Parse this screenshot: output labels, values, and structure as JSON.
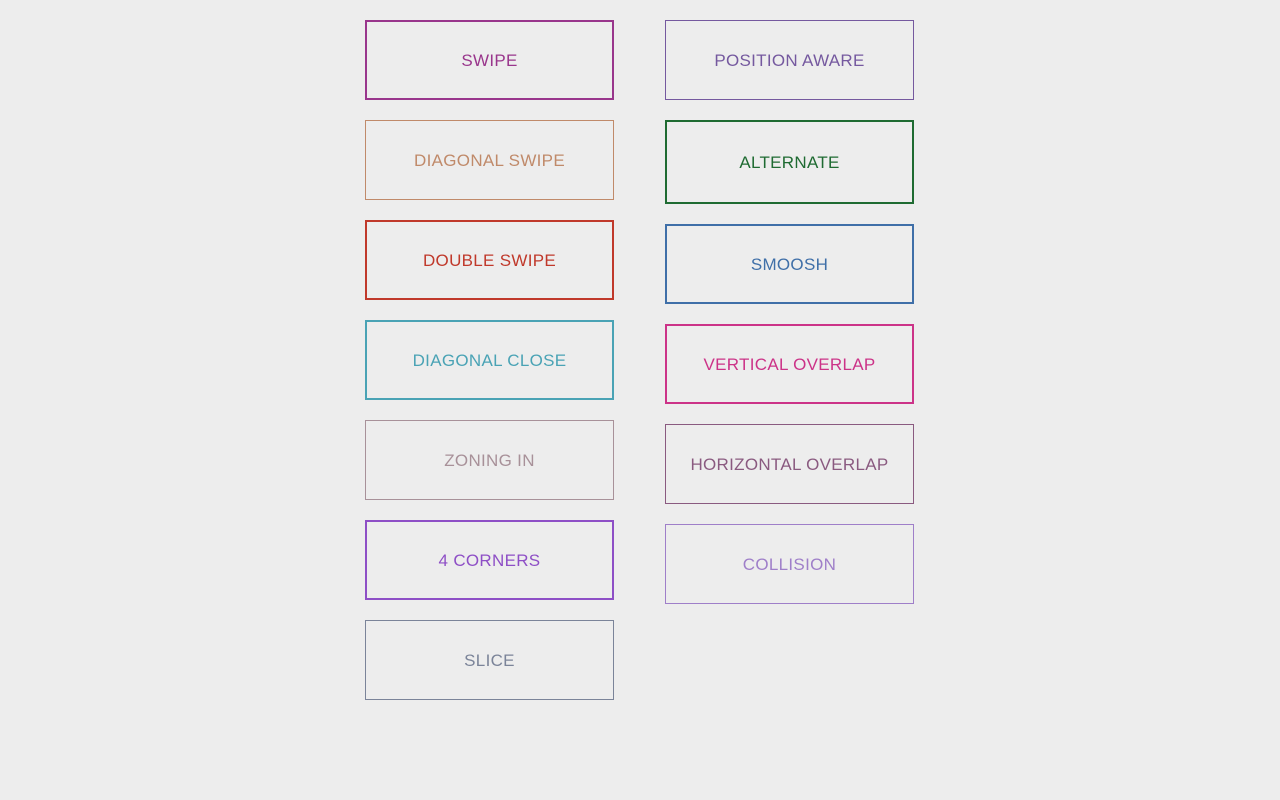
{
  "page": {
    "background_color": "#ededed",
    "cell_background_color": "#ededed"
  },
  "grid": {
    "columns": [
      {
        "name": "left-column",
        "cells": [
          {
            "label": "SWIPE",
            "color": "#99368c",
            "border_width": 2,
            "height": 80
          },
          {
            "label": "DIAGONAL SWIPE",
            "color": "#c08a6a",
            "border_width": 1,
            "height": 80
          },
          {
            "label": "DOUBLE SWIPE",
            "color": "#c0392b",
            "border_width": 2,
            "height": 80
          },
          {
            "label": "DIAGONAL CLOSE",
            "color": "#4aa3b5",
            "border_width": 2,
            "height": 80
          },
          {
            "label": "ZONING IN",
            "color": "#a89199",
            "border_width": 1,
            "height": 80
          },
          {
            "label": "4 CORNERS",
            "color": "#8e4fc6",
            "border_width": 2,
            "height": 80
          },
          {
            "label": "SLICE",
            "color": "#7b8499",
            "border_width": 1,
            "height": 80
          }
        ]
      },
      {
        "name": "right-column",
        "cells": [
          {
            "label": "POSITION AWARE",
            "color": "#75599f",
            "border_width": 1,
            "height": 80
          },
          {
            "label": "ALTERNATE",
            "color": "#1f6b32",
            "border_width": 2,
            "height": 84
          },
          {
            "label": "SMOOSH",
            "color": "#3f6fa8",
            "border_width": 2,
            "height": 80
          },
          {
            "label": "VERTICAL OVERLAP",
            "color": "#cc3388",
            "border_width": 2,
            "height": 80
          },
          {
            "label": "HORIZONTAL OVERLAP",
            "color": "#8a5a80",
            "border_width": 1,
            "height": 80
          },
          {
            "label": "COLLISION",
            "color": "#9f7fc9",
            "border_width": 1,
            "height": 80
          }
        ]
      }
    ]
  }
}
